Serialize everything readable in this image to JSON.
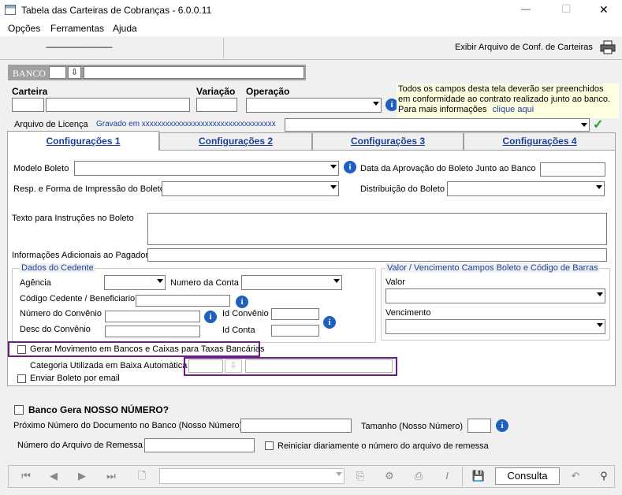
{
  "window": {
    "title": "Tabela das Carteiras de Cobranças - 6.0.0.11",
    "minimize": "—",
    "maximize": "☐",
    "close": "✕"
  },
  "menu": [
    "Opções",
    "Ferramentas",
    "Ajuda"
  ],
  "toolbar": {
    "dots": "------------------------------------",
    "export_label": "Exibir Arquivo de Conf. de Carteiras"
  },
  "banco": {
    "label": "BANCO",
    "code": "",
    "name": ""
  },
  "carteira": {
    "label": "Carteira",
    "variacao_label": "Variação",
    "operacao_label": "Operação",
    "notice": "Todos os campos desta tela deverão ser preenchidos em conformidade ao contrato realizado junto ao banco. Para mais informações",
    "notice_link": "clique aqui"
  },
  "licenca": {
    "label": "Arquivo de Licença",
    "saved": "Gravado em xxxxxxxxxxxxxxxxxxxxxxxxxxxxxxxxxx"
  },
  "tabs": [
    "Configurações 1",
    "Configurações 2",
    "Configurações 3",
    "Configurações 4"
  ],
  "config1": {
    "modelo_boleto": "Modelo Boleto",
    "data_aprovacao": "Data da Aprovação do Boleto Junto ao Banco",
    "resp_impressao": "Resp. e Forma de Impressão do Boleto",
    "distribuicao": "Distribuição do Boleto",
    "texto_instrucoes": "Texto para Instruções no Boleto",
    "info_adicionais": "Informações Adicionais ao Pagador"
  },
  "cedente": {
    "title": "Dados do Cedente",
    "agencia": "Agência",
    "numero_conta": "Numero da Conta",
    "codigo_cedente": "Código Cedente / Beneficiario",
    "numero_convenio": "Número do Convênio",
    "id_convenio": "Id Convênio",
    "desc_convenio": "Desc do Convênio",
    "id_conta": "Id Conta"
  },
  "valor_venc": {
    "title": "Valor / Vencimento Campos Boleto e Código de Barras",
    "valor": "Valor",
    "vencimento": "Vencimento"
  },
  "opcoes": {
    "gerar_movimento": "Gerar Movimento em Bancos e Caixas  para Taxas Bancárias",
    "categoria": "Categoria Utilizada em Baixa Automática",
    "enviar_email": "Enviar Boleto por email"
  },
  "nosso_numero": {
    "banco_gera": "Banco Gera NOSSO NÚMERO?",
    "proximo": "Próximo Número do Documento no Banco (Nosso Número)",
    "tamanho": "Tamanho (Nosso Número)",
    "remessa": "Número do Arquivo de Remessa",
    "reiniciar": "Reiniciar diariamente o número do arquivo de remessa"
  },
  "bottom": {
    "consulta": "Consulta"
  },
  "colors": {
    "accent": "#1a3f9c",
    "highlight": "#6a1b8a",
    "banco_bar": "#a0a0a0",
    "check": "#1e9e2e"
  }
}
